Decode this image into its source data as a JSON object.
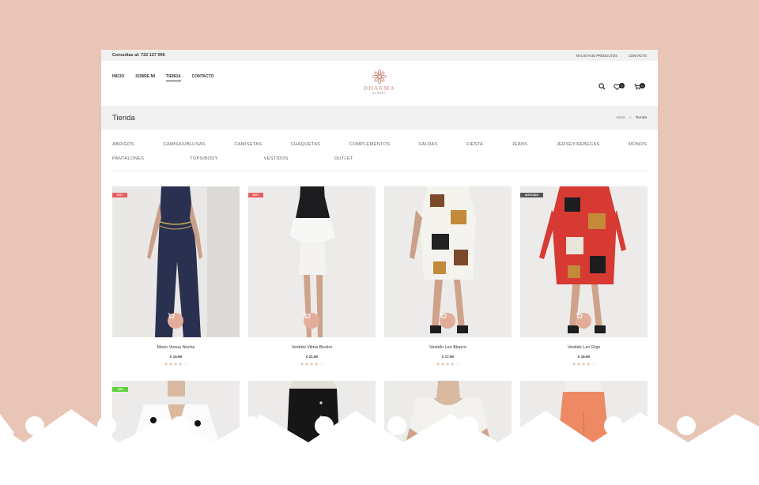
{
  "topbar": {
    "contact": "Consultas al: 722 127 096",
    "links": [
      "MI LISTA DE PRODUCTOS",
      "CONTACTO"
    ]
  },
  "nav": [
    "INICIO",
    "SOBRE MI",
    "TIENDA",
    "CONTACTO"
  ],
  "logo": {
    "brand": "DHARMA",
    "sub": "CLOSET"
  },
  "header_actions": {
    "wishlist_count": "0",
    "cart_count": "0",
    "icons": [
      "search-icon",
      "heart-icon",
      "cart-icon"
    ]
  },
  "page": {
    "title": "Tienda",
    "breadcrumb": [
      "Inicio",
      "Tienda"
    ],
    "breadcrumb_sep": ">"
  },
  "categories_row1": [
    "ABRIGOS",
    "CAMISAS/BLUSAS",
    "CAMISETAS",
    "CHAQUETAS",
    "COMPLEMENTOS",
    "FALDAS",
    "FIESTA",
    "JEANS",
    "JERSEY/REBECAS",
    "MONOS"
  ],
  "categories_row2": [
    "PANTALONES",
    "TOPS/BODY",
    "VESTIDOS",
    "OUTLET"
  ],
  "products": [
    {
      "name": "Mono Venus Noche",
      "price": "€ 15.99",
      "tag": "HOT",
      "tag_color": "#e95e5e",
      "rating": 4
    },
    {
      "name": "Vestido Vilma Bicolor",
      "price": "€ 21.90",
      "tag": "HOT",
      "tag_color": "#e95e5e",
      "rating": 4
    },
    {
      "name": "Vestido Leo Blanco",
      "price": "€ 17.90",
      "tag": "",
      "tag_color": "",
      "rating": 4
    },
    {
      "name": "Vestido Leo Rojo",
      "price": "€ 16.90",
      "tag": "AGOTADO",
      "tag_color": "#555555",
      "rating": 4
    }
  ],
  "products_row2": [
    {
      "tag": "-15%",
      "tag_color": "#5cd13c"
    },
    {
      "tag": "",
      "tag_color": ""
    },
    {
      "tag": "",
      "tag_color": ""
    },
    {
      "tag": "",
      "tag_color": ""
    }
  ],
  "colors": {
    "accent": "#e2ad9a",
    "background": "#e8c5b5",
    "topbar": "#f1f1f2"
  }
}
